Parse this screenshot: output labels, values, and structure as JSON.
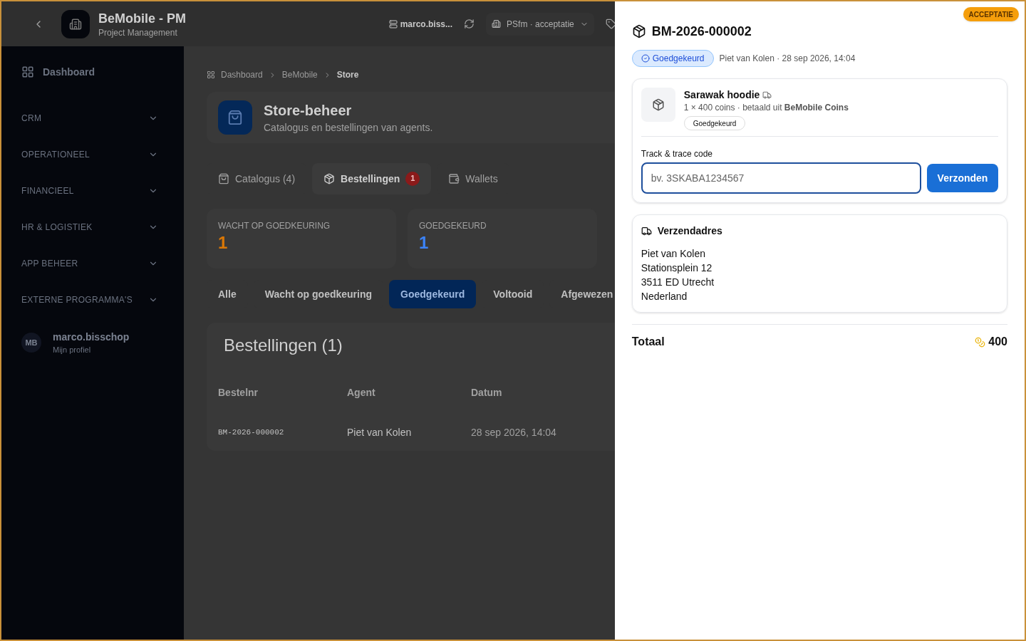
{
  "app": {
    "title": "BeMobile - PM",
    "subtitle": "Project Management"
  },
  "topbar": {
    "user": "marco.biss...",
    "environment": "PSfm · acceptatie"
  },
  "sidebar": {
    "items": [
      {
        "kind": "link",
        "label": "Dashboard"
      },
      {
        "kind": "section",
        "label": "CRM",
        "expanded": false
      },
      {
        "kind": "section",
        "label": "OPERATIONEEL",
        "expanded": false
      },
      {
        "kind": "section",
        "label": "FINANCIEEL",
        "expanded": false
      },
      {
        "kind": "section",
        "label": "HR & LOGISTIEK",
        "expanded": false
      },
      {
        "kind": "section",
        "label": "APP BEHEER",
        "expanded": false
      },
      {
        "kind": "section",
        "label": "EXTERNE PROGRAMMA'S",
        "expanded": false
      }
    ],
    "profile": {
      "initials": "MB",
      "name": "marco.bisschop",
      "subtitle": "Mijn profiel"
    }
  },
  "breadcrumb": [
    "Dashboard",
    "BeMobile",
    "Store"
  ],
  "page_header": {
    "title": "Store-beheer",
    "subtitle": "Catalogus en bestellingen van agents."
  },
  "tabs": [
    {
      "kind": "bag",
      "label": "Catalogus (4)",
      "selected": false
    },
    {
      "kind": "box",
      "label": "Bestellingen",
      "badge": "1",
      "selected": true
    },
    {
      "kind": "wallet",
      "label": "Wallets",
      "selected": false
    }
  ],
  "stats": [
    {
      "label": "WACHT OP GOEDKEURING",
      "value": "1",
      "color": "#d97706"
    },
    {
      "label": "GOEDGEKEURD",
      "value": "1",
      "color": "#3b82f6"
    }
  ],
  "filters": [
    {
      "label": "Alle",
      "selected": false
    },
    {
      "label": "Wacht op goedkeuring",
      "selected": false
    },
    {
      "label": "Goedgekeurd",
      "selected": true
    },
    {
      "label": "Voltooid",
      "selected": false
    },
    {
      "label": "Afgewezen",
      "selected": false
    }
  ],
  "orders_table": {
    "title": "Bestellingen (1)",
    "columns": [
      "Bestelnr",
      "Agent",
      "Datum"
    ],
    "rows": [
      [
        "BM-2026-000002",
        "Piet van Kolen",
        "28 sep 2026, 14:04"
      ]
    ]
  },
  "env_badge": "ACCEPTATIE",
  "drawer": {
    "title": "BM-2026-000002",
    "status": "Goedgekeurd",
    "meta": "Piet van Kolen · 28 sep 2026, 14:04",
    "item": {
      "name": "Sarawak hoodie",
      "shipping": true,
      "detail": "1 × 400 coins · betaald uit **BeMobile Coins**",
      "status": "Goedgekeurd"
    },
    "tracking": {
      "label": "Track & trace code",
      "placeholder": "bv. 3SKABA1234567",
      "button": "Verzonden"
    },
    "address": {
      "title": "Verzendadres",
      "lines": [
        "Piet van Kolen",
        "Stationsplein 12",
        "3511 ED Utrecht",
        "Nederland"
      ]
    },
    "total": {
      "label": "Totaal",
      "value": "400"
    }
  }
}
